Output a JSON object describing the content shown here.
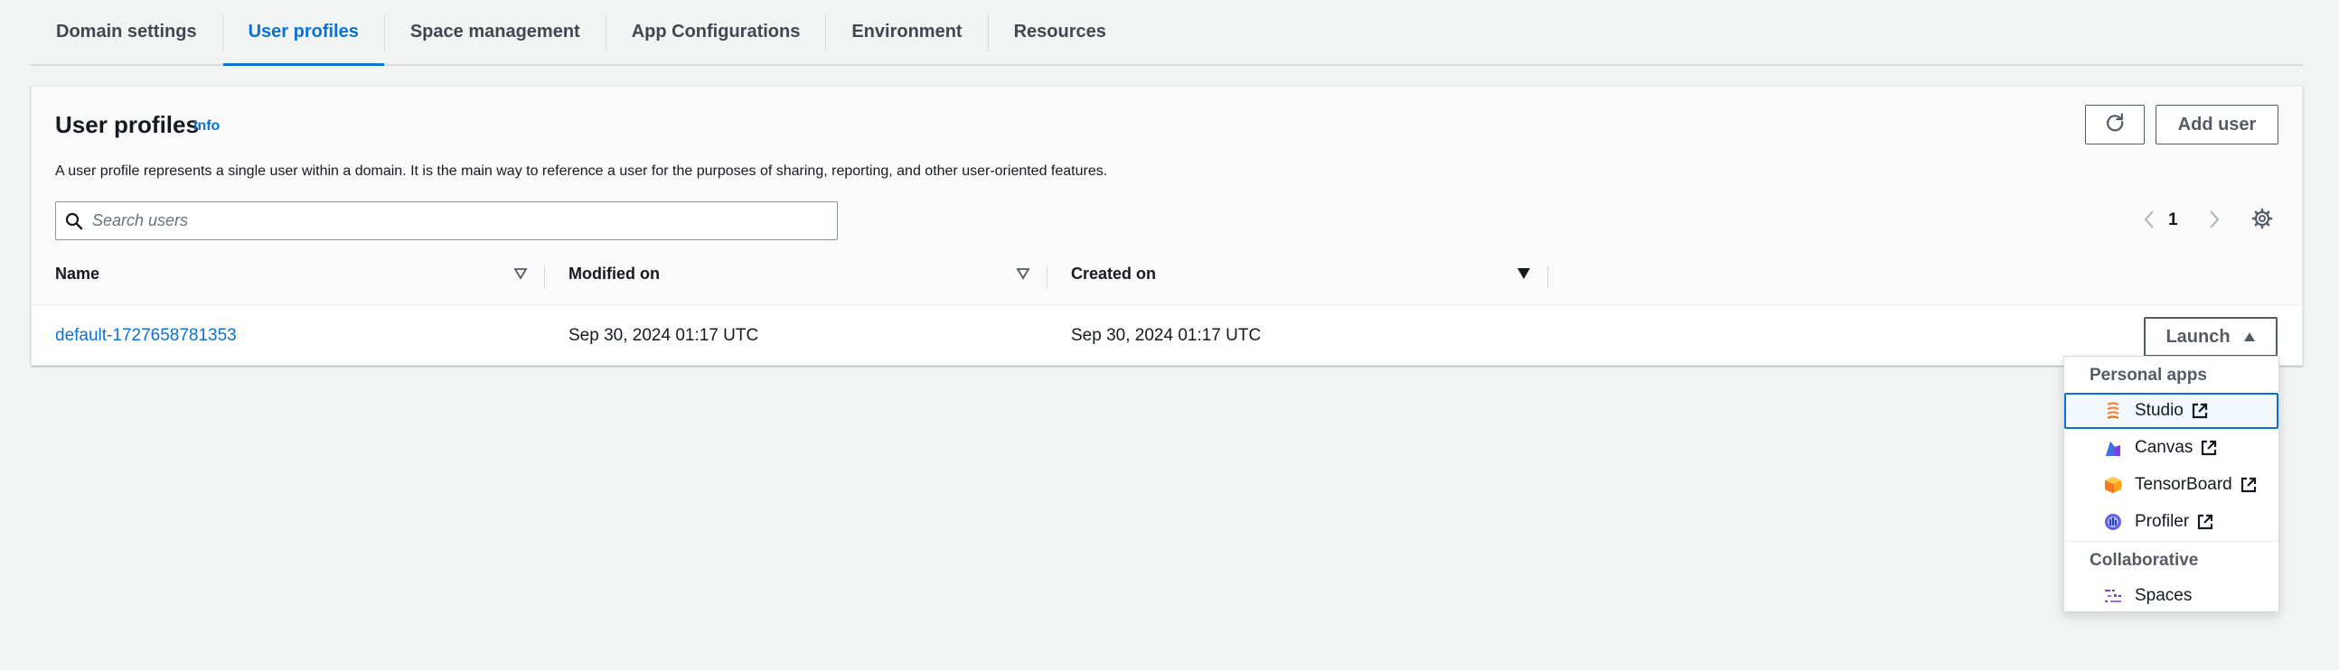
{
  "tabs": [
    {
      "label": "Domain settings",
      "active": false
    },
    {
      "label": "User profiles",
      "active": true
    },
    {
      "label": "Space management",
      "active": false
    },
    {
      "label": "App Configurations",
      "active": false
    },
    {
      "label": "Environment",
      "active": false
    },
    {
      "label": "Resources",
      "active": false
    }
  ],
  "panel": {
    "title": "User profiles",
    "info": "Info",
    "description": "A user profile represents a single user within a domain. It is the main way to reference a user for the purposes of sharing, reporting, and other user-oriented features.",
    "add_user_label": "Add user",
    "search_placeholder": "Search users",
    "current_page": "1"
  },
  "table": {
    "columns": [
      "Name",
      "Modified on",
      "Created on"
    ],
    "rows": [
      {
        "name": "default-1727658781353",
        "modified_on": "Sep 30, 2024 01:17 UTC",
        "created_on": "Sep 30, 2024 01:17 UTC",
        "action": "Launch"
      }
    ]
  },
  "launch_menu": {
    "groups": [
      {
        "label": "Personal apps",
        "items": [
          {
            "label": "Studio",
            "icon": "studio-icon",
            "external": true
          },
          {
            "label": "Canvas",
            "icon": "canvas-icon",
            "external": true
          },
          {
            "label": "TensorBoard",
            "icon": "tensorboard-icon",
            "external": true
          },
          {
            "label": "Profiler",
            "icon": "profiler-icon",
            "external": true
          }
        ]
      },
      {
        "label": "Collaborative",
        "items": [
          {
            "label": "Spaces",
            "icon": "spaces-icon",
            "external": false
          }
        ]
      }
    ]
  },
  "colors": {
    "accent": "#0972d3",
    "text": "#16191f",
    "muted": "#545b64",
    "background": "#f2f3f3"
  }
}
